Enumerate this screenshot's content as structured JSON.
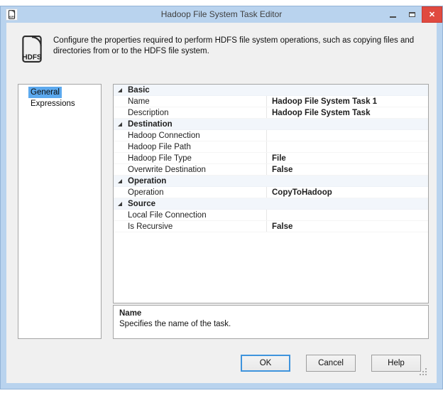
{
  "window": {
    "title": "Hadoop File System Task Editor"
  },
  "header": {
    "icon_label": "HDFS",
    "description": "Configure the properties required to perform HDFS file system operations, such as copying files and directories from or to the HDFS file system."
  },
  "nav": {
    "items": [
      {
        "label": "General",
        "selected": true
      },
      {
        "label": "Expressions",
        "selected": false
      }
    ]
  },
  "property_grid": {
    "rows": [
      {
        "type": "category",
        "label": "Basic"
      },
      {
        "type": "property",
        "label": "Name",
        "value": "Hadoop File System Task 1"
      },
      {
        "type": "property",
        "label": "Description",
        "value": "Hadoop File System Task"
      },
      {
        "type": "category",
        "label": "Destination"
      },
      {
        "type": "property",
        "label": "Hadoop Connection",
        "value": ""
      },
      {
        "type": "property",
        "label": "Hadoop File Path",
        "value": ""
      },
      {
        "type": "property",
        "label": "Hadoop File Type",
        "value": "File"
      },
      {
        "type": "property",
        "label": "Overwrite Destination",
        "value": "False"
      },
      {
        "type": "category",
        "label": "Operation"
      },
      {
        "type": "property",
        "label": "Operation",
        "value": "CopyToHadoop"
      },
      {
        "type": "category",
        "label": "Source"
      },
      {
        "type": "property",
        "label": "Local File Connection",
        "value": ""
      },
      {
        "type": "property",
        "label": "Is Recursive",
        "value": "False"
      }
    ]
  },
  "detail": {
    "title": "Name",
    "description": "Specifies the name of the task."
  },
  "buttons": {
    "ok": "OK",
    "cancel": "Cancel",
    "help": "Help"
  },
  "colors": {
    "titlebar": "#b9d3ee",
    "close_button": "#e04a40",
    "selection": "#5ca9ee",
    "category_row_tint": "#f2f6fb"
  }
}
